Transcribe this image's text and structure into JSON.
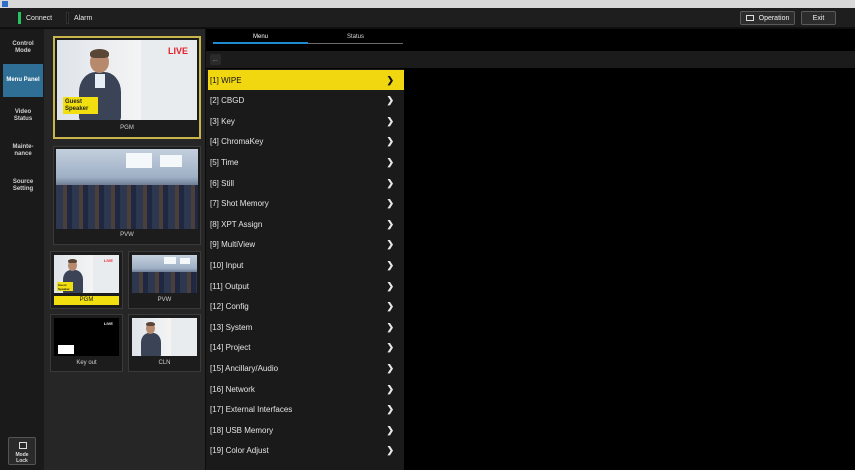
{
  "topbar": {
    "connect_label": "Connect",
    "connect_color": "#22c55e",
    "alarm_label": "Alarm",
    "alarm_color": "#111111",
    "operation_label": "Operation",
    "exit_label": "Exit"
  },
  "sidebar": {
    "items": [
      {
        "label": "Control Mode",
        "active": false
      },
      {
        "label": "Menu Panel",
        "active": true
      },
      {
        "label": "Video Status",
        "active": false
      },
      {
        "label": "Mainte-nance",
        "active": false
      },
      {
        "label": "Source Setting",
        "active": false
      }
    ],
    "mode_lock_label": "Mode Lock"
  },
  "monitors": {
    "large": [
      {
        "label": "PGM",
        "live_label": "LIVE",
        "guest_label": "Guest Speaker"
      },
      {
        "label": "PVW"
      }
    ],
    "small": [
      {
        "label": "PGM",
        "live_label": "LIVE",
        "guest_label": "Guest Speaker"
      },
      {
        "label": "PVW"
      },
      {
        "label": "Key out",
        "live_label": "LIVE"
      },
      {
        "label": "CLN"
      }
    ]
  },
  "tabs": [
    {
      "label": "Menu",
      "active": true
    },
    {
      "label": "Status",
      "active": false
    }
  ],
  "back_icon": "←",
  "menu": {
    "items": [
      {
        "label": "[1] WIPE"
      },
      {
        "label": "[2] CBGD"
      },
      {
        "label": "[3] Key"
      },
      {
        "label": "[4] ChromaKey"
      },
      {
        "label": "[5] Time"
      },
      {
        "label": "[6] Still"
      },
      {
        "label": "[7] Shot Memory"
      },
      {
        "label": "[8] XPT Assign"
      },
      {
        "label": "[9] MultiView"
      },
      {
        "label": "[10] Input"
      },
      {
        "label": "[11] Output"
      },
      {
        "label": "[12] Config"
      },
      {
        "label": "[13] System"
      },
      {
        "label": "[14] Project"
      },
      {
        "label": "[15] Ancillary/Audio"
      },
      {
        "label": "[16] Network"
      },
      {
        "label": "[17] External Interfaces"
      },
      {
        "label": "[18] USB Memory"
      },
      {
        "label": "[19] Color Adjust"
      }
    ],
    "chevron": "❯"
  },
  "colors": {
    "accent_yellow": "#f0d710",
    "active_tab_blue": "#1f8ad0",
    "sidebar_active": "#2f6f95"
  }
}
